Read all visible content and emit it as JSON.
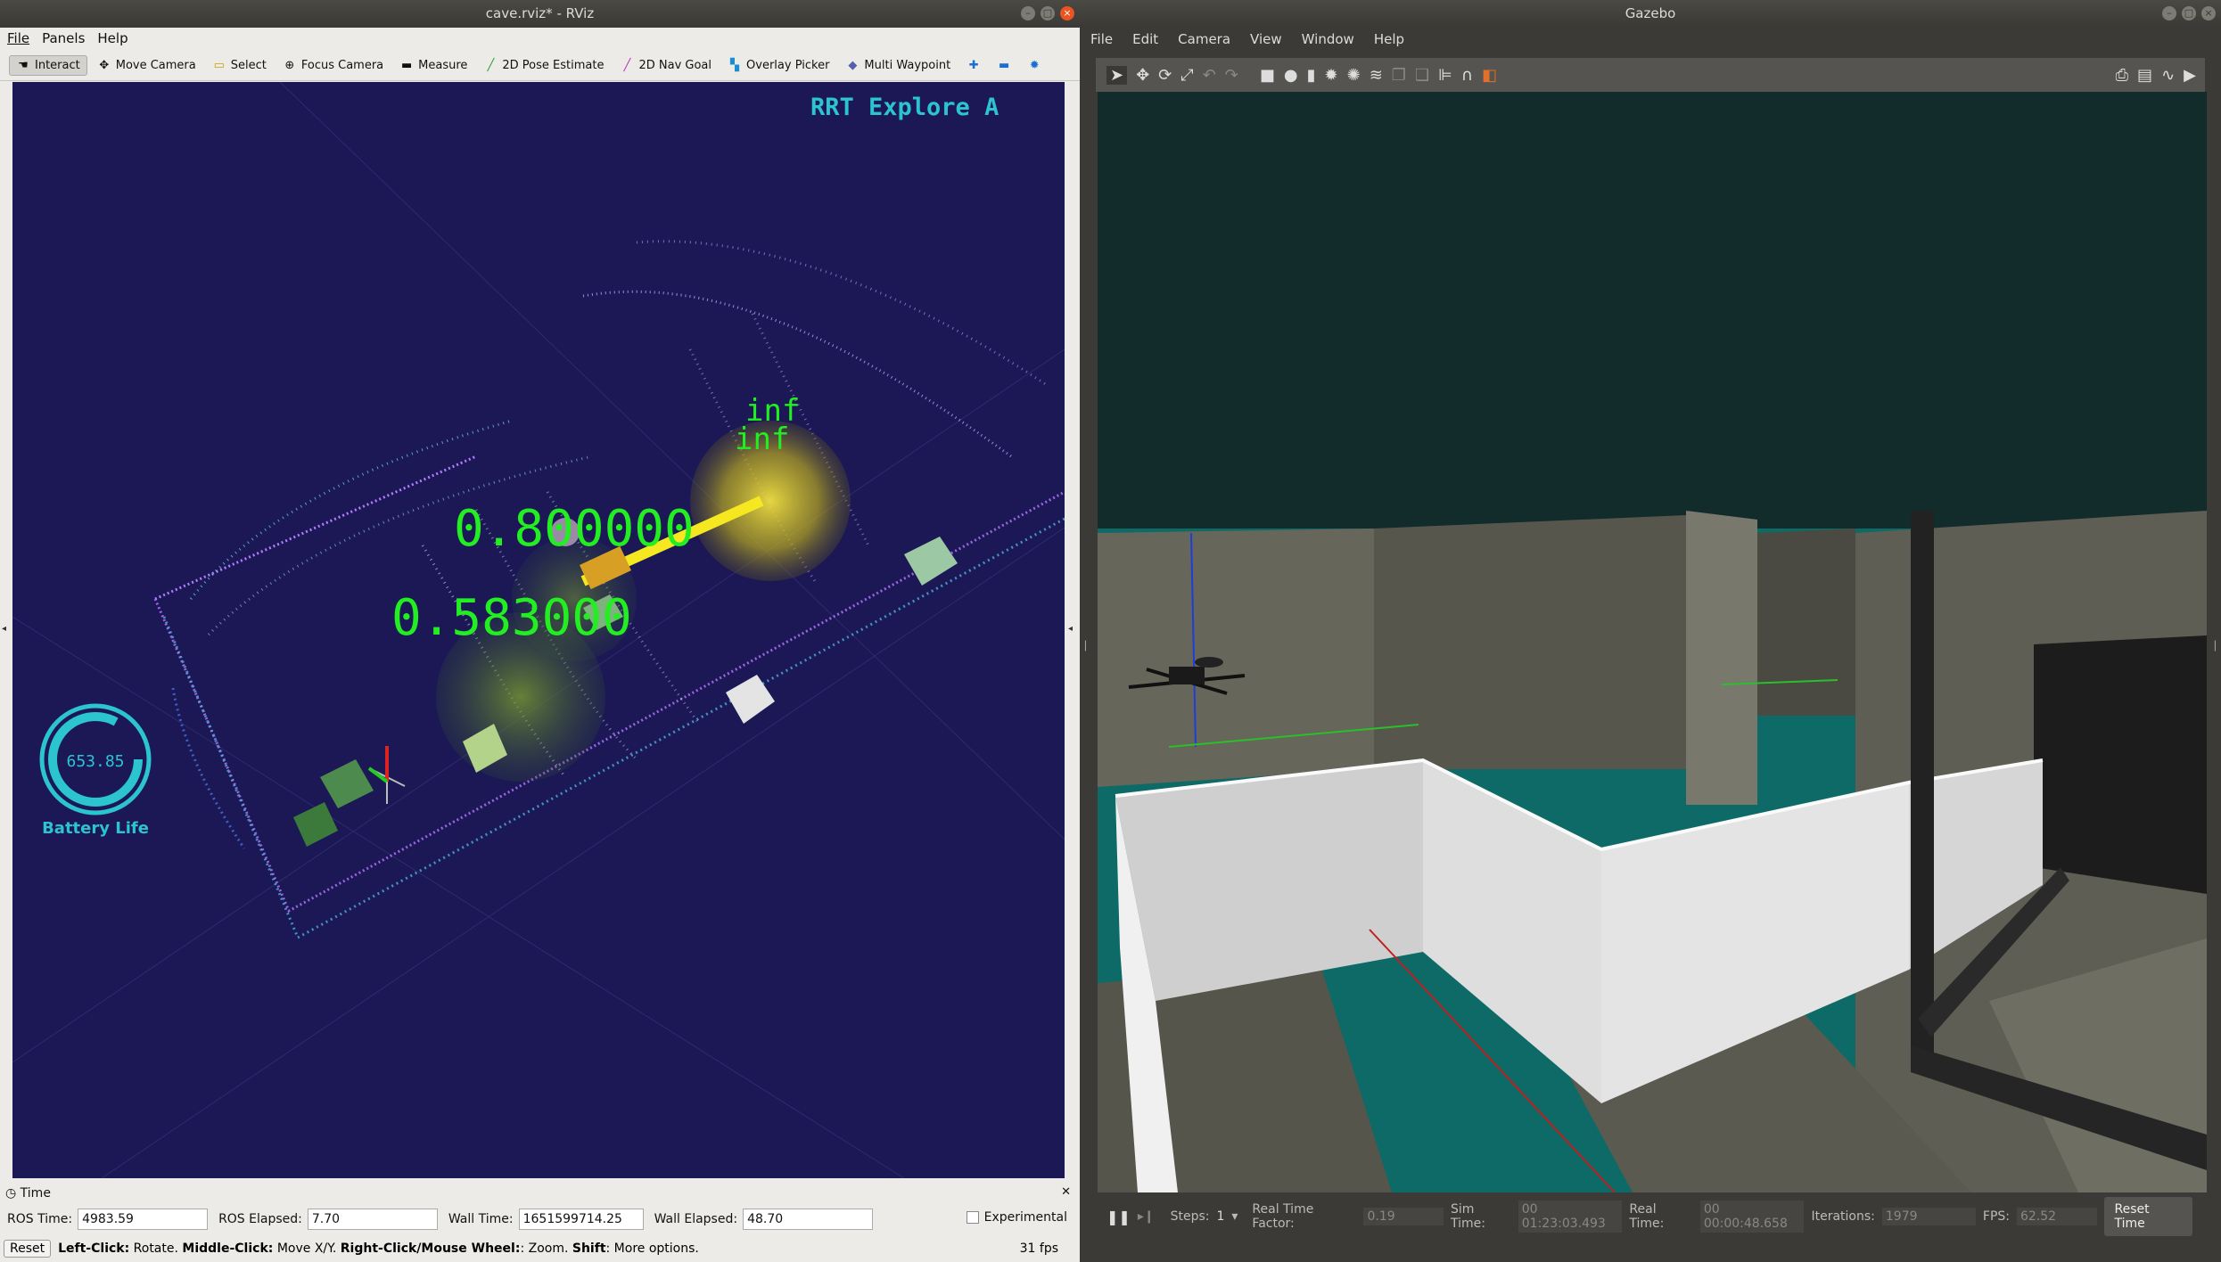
{
  "rviz": {
    "title": "cave.rviz* - RViz",
    "menu": [
      "File",
      "Panels",
      "Help"
    ],
    "tools": [
      {
        "label": "Interact",
        "icon": "hand-icon"
      },
      {
        "label": "Move Camera",
        "icon": "move-camera-icon"
      },
      {
        "label": "Select",
        "icon": "select-icon"
      },
      {
        "label": "Focus Camera",
        "icon": "focus-camera-icon"
      },
      {
        "label": "Measure",
        "icon": "ruler-icon"
      },
      {
        "label": "2D Pose Estimate",
        "icon": "pose-arrow-icon"
      },
      {
        "label": "2D Nav Goal",
        "icon": "nav-goal-arrow-icon"
      },
      {
        "label": "Overlay Picker",
        "icon": "overlay-picker-icon"
      },
      {
        "label": "Multi Waypoint",
        "icon": "waypoint-icon"
      }
    ],
    "view": {
      "overlay_title": "RRT Explore A",
      "label_a": "0.800000",
      "label_b": "0.583000",
      "label_inf1": "inf",
      "label_inf2": "inf",
      "battery_value": "653.85",
      "battery_label": "Battery Life"
    },
    "time_panel": {
      "title": "Time",
      "ros_time_label": "ROS Time:",
      "ros_time": "4983.59",
      "ros_elapsed_label": "ROS Elapsed:",
      "ros_elapsed": "7.70",
      "wall_time_label": "Wall Time:",
      "wall_time": "1651599714.25",
      "wall_elapsed_label": "Wall Elapsed:",
      "wall_elapsed": "48.70",
      "experimental": "Experimental"
    },
    "status": {
      "reset": "Reset",
      "lc": "Left-Click:",
      "lc_text": "Rotate.",
      "mc": "Middle-Click:",
      "mc_text": "Move X/Y.",
      "rc": "Right-Click/Mouse Wheel:",
      "rc_text": ": Zoom.",
      "sh": "Shift",
      "sh_text": ": More options.",
      "fps": "31 fps"
    }
  },
  "gazebo": {
    "title": "Gazebo",
    "menu": [
      "File",
      "Edit",
      "Camera",
      "View",
      "Window",
      "Help"
    ],
    "bottom": {
      "steps_label": "Steps:",
      "steps_value": "1",
      "rtf_label": "Real Time Factor:",
      "rtf": "0.19",
      "sim_time_label": "Sim Time:",
      "sim_time": "00 01:23:03.493",
      "real_time_label": "Real Time:",
      "real_time": "00 00:00:48.658",
      "iterations_label": "Iterations:",
      "iterations": "1979",
      "fps_label": "FPS:",
      "fps": "62.52",
      "reset_time": "Reset Time"
    }
  },
  "colors": {
    "rviz_bg": "#1b1855",
    "overlay_cyan": "#2bc4cf",
    "label_green": "#22ee22",
    "gazebo_floor": "#0e6b66",
    "wall_white": "#e0e0e0"
  }
}
